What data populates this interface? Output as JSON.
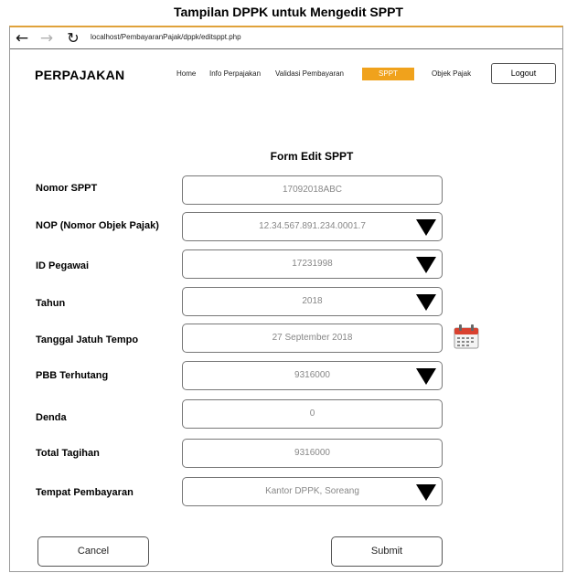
{
  "caption": "Tampilan DPPK untuk Mengedit SPPT",
  "browser": {
    "url": "localhost/PembayaranPajak/dppk/editsppt.php",
    "icons": [
      "arrow-left-icon",
      "arrow-right-icon",
      "reload-icon"
    ]
  },
  "header": {
    "brand": "PERPAJAKAN",
    "menu": {
      "home": "Home",
      "info": "Info Perpajakan",
      "validasi": "Validasi Pembayaran",
      "sppt": "SPPT",
      "objek": "Objek Pajak"
    },
    "logout": "Logout",
    "active_color": "#f0a21c"
  },
  "form": {
    "title": "Form Edit SPPT",
    "fields": {
      "nomor_sppt": {
        "label": "Nomor SPPT",
        "value": "17092018ABC"
      },
      "nop": {
        "label": "NOP (Nomor Objek Pajak)",
        "value": "12.34.567.891.234.0001.7"
      },
      "id_pegawai": {
        "label": "ID Pegawai",
        "value": "17231998"
      },
      "tahun": {
        "label": "Tahun",
        "value": "2018"
      },
      "tanggal": {
        "label": "Tanggal Jatuh Tempo",
        "value": "27 September 2018"
      },
      "pbb": {
        "label": "PBB Terhutang",
        "value": "9316000"
      },
      "denda": {
        "label": "Denda",
        "value": "0"
      },
      "total": {
        "label": "Total Tagihan",
        "value": "9316000"
      },
      "tempat": {
        "label": "Tempat Pembayaran",
        "value": "Kantor DPPK, Soreang"
      }
    },
    "cancel": "Cancel",
    "submit": "Submit"
  }
}
